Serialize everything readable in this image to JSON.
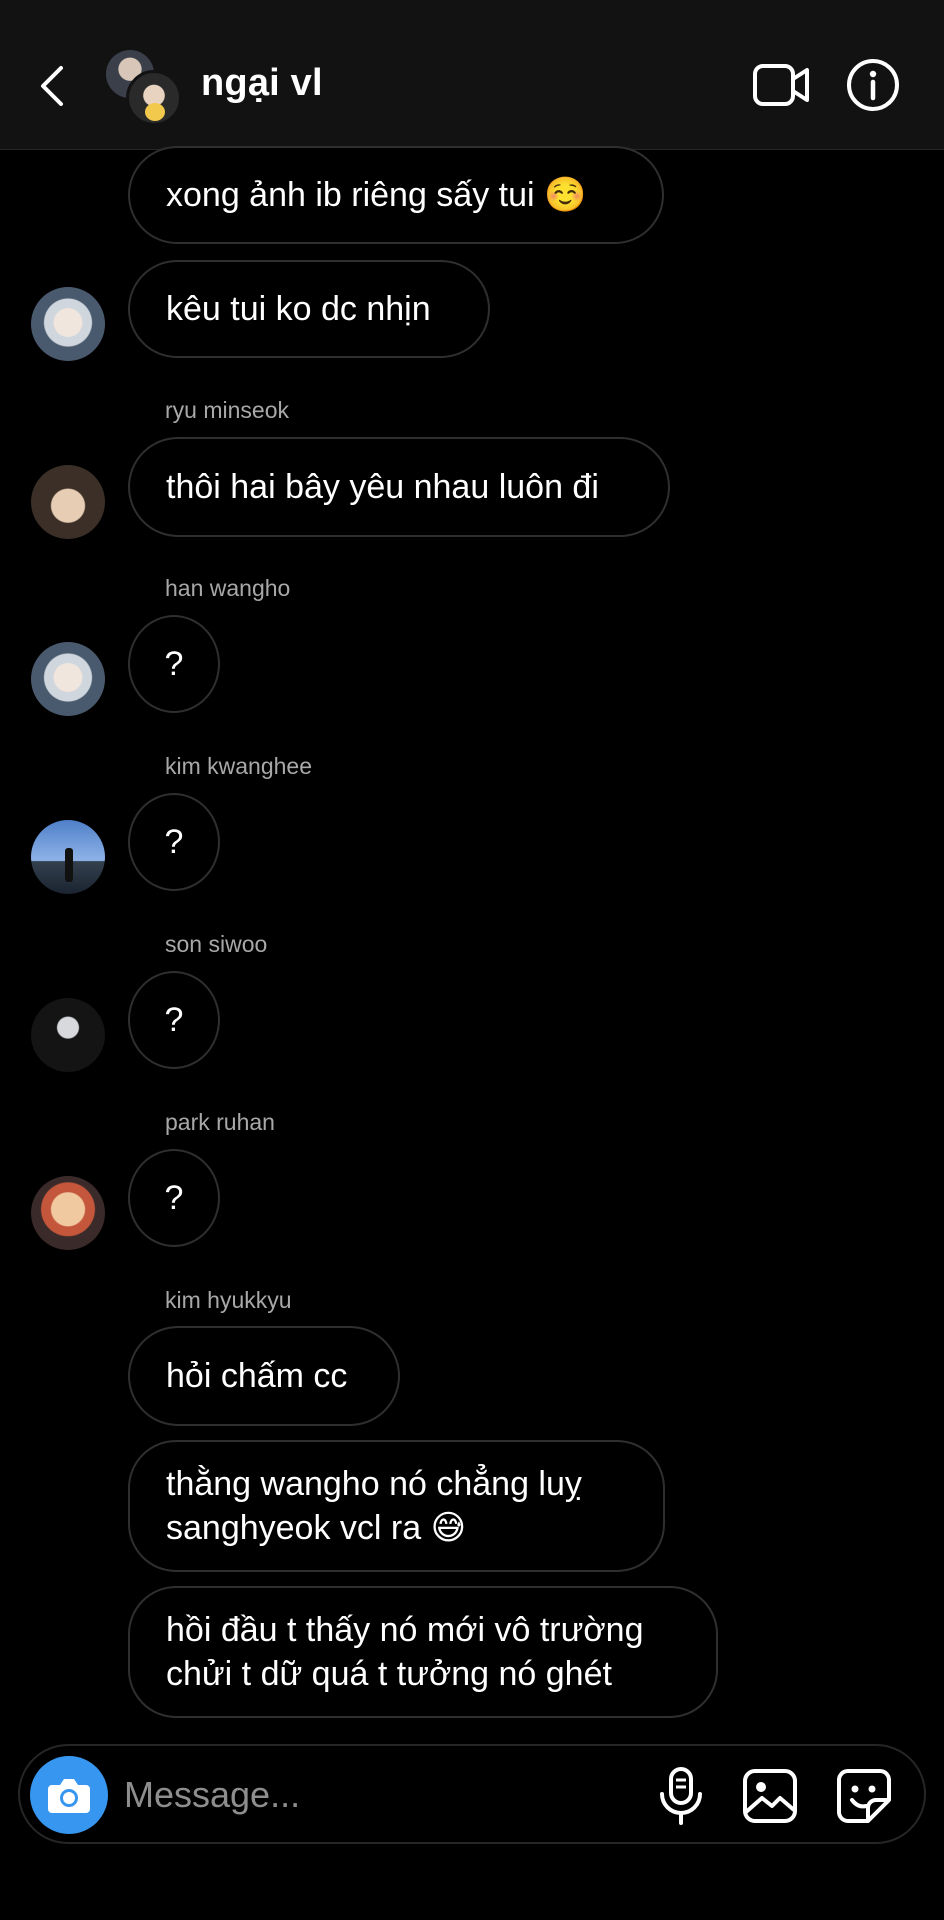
{
  "header": {
    "title": "ngại vl",
    "back_icon": "chevron-left-icon",
    "video_icon": "video-call-icon",
    "info_icon": "info-icon"
  },
  "messages": [
    {
      "sender": "",
      "text": "xong ảnh ib riêng sấy tui ☺️"
    },
    {
      "sender": "",
      "text": "kêu tui ko dc nhịn"
    },
    {
      "sender": "ryu minseok",
      "text": "thôi hai bây yêu nhau luôn đi"
    },
    {
      "sender": "han wangho",
      "text": "?"
    },
    {
      "sender": "kim kwanghee",
      "text": "?"
    },
    {
      "sender": "son siwoo",
      "text": "?"
    },
    {
      "sender": "park ruhan",
      "text": "?"
    },
    {
      "sender": "kim hyukkyu",
      "text": "hỏi chấm cc"
    },
    {
      "sender": "",
      "text_lines": [
        "thằng wangho nó chẳng luỵ",
        "sanghyeok vcl ra 😅"
      ]
    },
    {
      "sender": "",
      "text_lines": [
        "hồi đầu t thấy nó mới vô trường",
        "chửi t dữ quá t tưởng nó ghét"
      ]
    }
  ],
  "composer": {
    "placeholder": "Message...",
    "camera_icon": "camera-icon",
    "mic_icon": "microphone-icon",
    "gallery_icon": "gallery-icon",
    "sticker_icon": "sticker-icon",
    "accent_color": "#3797f0"
  }
}
